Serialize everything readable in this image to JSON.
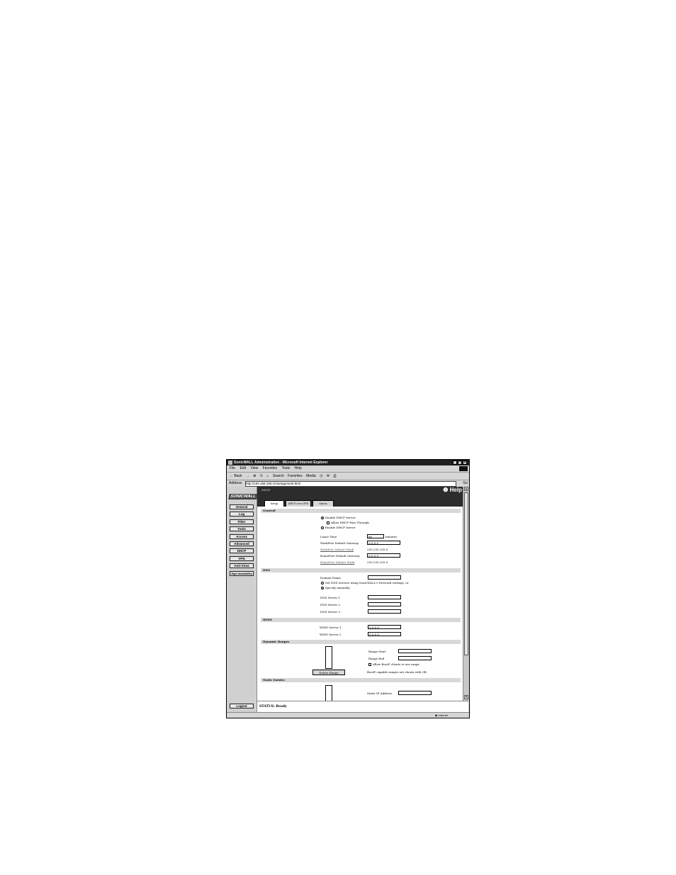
{
  "window": {
    "title": "SonicWALL Administration - Microsoft Internet Explorer",
    "min": "_",
    "max": "□",
    "close": "×"
  },
  "menu": [
    "File",
    "Edit",
    "View",
    "Favorites",
    "Tools",
    "Help"
  ],
  "toolbar": {
    "back": "← Back",
    "forward": "→",
    "search": "Search",
    "favorites": "Favorites",
    "media": "Media"
  },
  "address": {
    "label": "Address",
    "url": "http://192.168.168.1/management.html",
    "go": "Go"
  },
  "sidebar": {
    "logo": "SONICWALL",
    "items": [
      "General",
      "Log",
      "Filter",
      "Tools",
      "Access",
      "Advanced",
      "DHCP",
      "VPN",
      "Anti-Virus",
      "High Availability"
    ],
    "logout": "Logout"
  },
  "page": {
    "title": "DHCP",
    "help": "Help",
    "tabs": [
      "Setup",
      "DHCP over VPN",
      "Status"
    ]
  },
  "general": {
    "heading": "General",
    "enable_dhcp": "Enable DHCP Server",
    "allow_pass": "Allow DHCP Pass Through",
    "enable_dhcp2": "Enable DHCP Server",
    "lease_label": "Lease Time",
    "lease_value": "60",
    "lease_unit": "minutes",
    "workport_gw_label": "WorkPort Default Gateway",
    "workport_gw_value": "0.0.0.0",
    "workport_mask_label": "WorkPort Subnet Mask",
    "workport_mask_value": "255.255.255.0",
    "homeport_gw_label": "HomePort Default Gateway",
    "homeport_gw_value": "0.0.0.0",
    "homeport_mask_label": "HomePort Subnet Mask",
    "homeport_mask_value": "255.255.255.0"
  },
  "dns": {
    "heading": "DNS",
    "domain_label": "Domain Name",
    "domain_value": "",
    "opt_set": "Set DNS Servers using SonicWALL's Network settings, or",
    "opt_manual": "Specify manually",
    "server1": "DNS Server 1",
    "server2": "DNS Server 2",
    "server3": "DNS Server 3"
  },
  "wins": {
    "heading": "WINS",
    "server1": "WINS Server 1",
    "server1_value": "0.0.0.0",
    "server2": "WINS Server 2",
    "server2_value": "0.0.0.0"
  },
  "ranges": {
    "heading": "Dynamic Ranges",
    "start_label": "Range Start",
    "end_label": "Range End",
    "bootp": "Allow BootP clients to use range",
    "note": "BootP capable ranges are shown with (B).",
    "delete_btn": "Delete Range"
  },
  "static": {
    "heading": "Static Entries",
    "ip_label": "Static IP Address"
  },
  "status": {
    "text": "STATUS: Ready"
  },
  "ie_status": {
    "zone": "Internet"
  }
}
